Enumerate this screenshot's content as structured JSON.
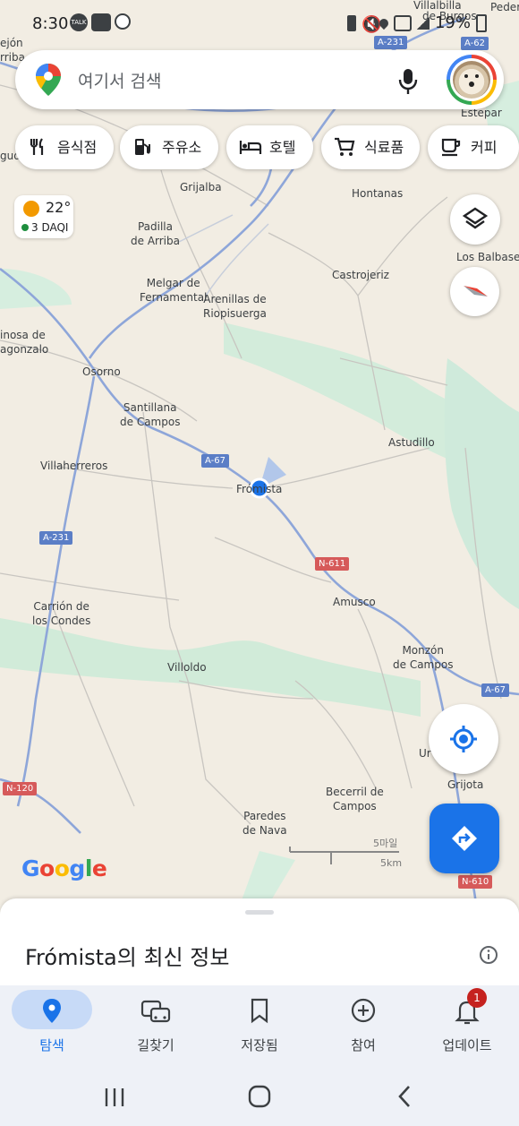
{
  "status_bar": {
    "time": "8:30",
    "talk": "TALK",
    "battery": "19%"
  },
  "search": {
    "placeholder": "여기서 검색"
  },
  "chips": [
    {
      "label": "음식점",
      "icon": "fork-knife-icon"
    },
    {
      "label": "주유소",
      "icon": "gas-station-icon"
    },
    {
      "label": "호텔",
      "icon": "bed-icon"
    },
    {
      "label": "식료품",
      "icon": "cart-icon"
    },
    {
      "label": "커피",
      "icon": "coffee-icon"
    }
  ],
  "weather": {
    "temp": "22°",
    "aqi": "3 DAQI"
  },
  "map": {
    "places": {
      "villalbilla": "Villalbilla",
      "de_burgos": "de Burgos",
      "pedern": "Pedern",
      "tejon": "ejón",
      "arriba_top": "rriba",
      "estepar": "Estepar",
      "grijalba": "Grijalba",
      "hontanas": "Hontanas",
      "gud": "gud",
      "padilla": "Padilla\nde Arriba",
      "los_balbases": "Los Balbases",
      "melgar": "Melgar de\nFernamental",
      "arenillas": "Arenillas de\nRiopisuerga",
      "castrojeriz": "Castrojeriz",
      "sinosa": "inosa de\nagonzalo",
      "osorno": "Osorno",
      "santillana": "Santillana\nde Campos",
      "astudillo": "Astudillo",
      "villaherreros": "Villaherreros",
      "fromista": "Frómista",
      "amusco": "Amusco",
      "carrion": "Carrión de\nlos Condes",
      "villoldo": "Villoldo",
      "monzon": "Monzón\nde Campos",
      "ur": "Ur",
      "grijota": "Grijota",
      "becerril": "Becerril de\nCampos",
      "paredes": "Paredes\nde Nava"
    },
    "roads": {
      "a231_top": "A-231",
      "a62": "A-62",
      "a67_mid": "A-67",
      "n611": "N-611",
      "a231_left": "A-231",
      "a67_right": "A-67",
      "n120": "N-120",
      "n610": "N-610"
    },
    "scale": {
      "miles": "5마일",
      "km": "5km"
    },
    "logo": "Google"
  },
  "sheet": {
    "title": "Frómista의 최신 정보"
  },
  "bottom_nav": [
    {
      "label": "탐색",
      "active": true
    },
    {
      "label": "길찾기"
    },
    {
      "label": "저장됨"
    },
    {
      "label": "참여"
    },
    {
      "label": "업데이트",
      "badge": "1"
    }
  ],
  "colors": {
    "accent": "#1a73e8",
    "water_green": "#cdebd9",
    "road_blue": "#8ea6d9",
    "badge": "#c5221f"
  }
}
